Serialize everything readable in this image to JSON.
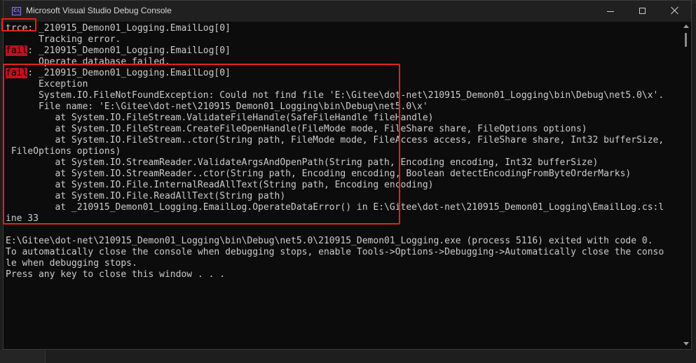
{
  "window": {
    "title": "Microsoft Visual Studio Debug Console",
    "icon_label": "C:\\"
  },
  "controls": {
    "minimize": "minimize-icon",
    "maximize": "maximize-icon",
    "close": "close-icon"
  },
  "colors": {
    "console_bg": "#0c0c0c",
    "console_text": "#cccccc",
    "fail_tag_bg": "#c50f1f",
    "annotation": "#e8201a"
  },
  "console": {
    "lines": [
      {
        "tag": "trce",
        "rest": ": _210915_Demon01_Logging.EmailLog[0]"
      },
      {
        "text": "      Tracking error."
      },
      {
        "tag": "fail",
        "rest": ": _210915_Demon01_Logging.EmailLog[0]"
      },
      {
        "text": "      Operate database failed."
      },
      {
        "tag": "fail",
        "rest": ": _210915_Demon01_Logging.EmailLog[0]"
      },
      {
        "text": "      Exception"
      },
      {
        "text": "      System.IO.FileNotFoundException: Could not find file 'E:\\Gitee\\dot-net\\210915_Demon01_Logging\\bin\\Debug\\net5.0\\x'."
      },
      {
        "text": "      File name: 'E:\\Gitee\\dot-net\\210915_Demon01_Logging\\bin\\Debug\\net5.0\\x'"
      },
      {
        "text": "         at System.IO.FileStream.ValidateFileHandle(SafeFileHandle fileHandle)"
      },
      {
        "text": "         at System.IO.FileStream.CreateFileOpenHandle(FileMode mode, FileShare share, FileOptions options)"
      },
      {
        "text": "         at System.IO.FileStream..ctor(String path, FileMode mode, FileAccess access, FileShare share, Int32 bufferSize,"
      },
      {
        "text": " FileOptions options)"
      },
      {
        "text": "         at System.IO.StreamReader.ValidateArgsAndOpenPath(String path, Encoding encoding, Int32 bufferSize)"
      },
      {
        "text": "         at System.IO.StreamReader..ctor(String path, Encoding encoding, Boolean detectEncodingFromByteOrderMarks)"
      },
      {
        "text": "         at System.IO.File.InternalReadAllText(String path, Encoding encoding)"
      },
      {
        "text": "         at System.IO.File.ReadAllText(String path)"
      },
      {
        "text": "         at _210915_Demon01_Logging.EmailLog.OperateDataError() in E:\\Gitee\\dot-net\\210915_Demon01_Logging\\EmailLog.cs:l"
      },
      {
        "text": "ine 33"
      },
      {
        "text": ""
      },
      {
        "text": "E:\\Gitee\\dot-net\\210915_Demon01_Logging\\bin\\Debug\\net5.0\\210915_Demon01_Logging.exe (process 5116) exited with code 0."
      },
      {
        "text": "To automatically close the console when debugging stops, enable Tools->Options->Debugging->Automatically close the conso"
      },
      {
        "text": "le when debugging stops."
      },
      {
        "text": "Press any key to close this window . . ."
      }
    ]
  }
}
